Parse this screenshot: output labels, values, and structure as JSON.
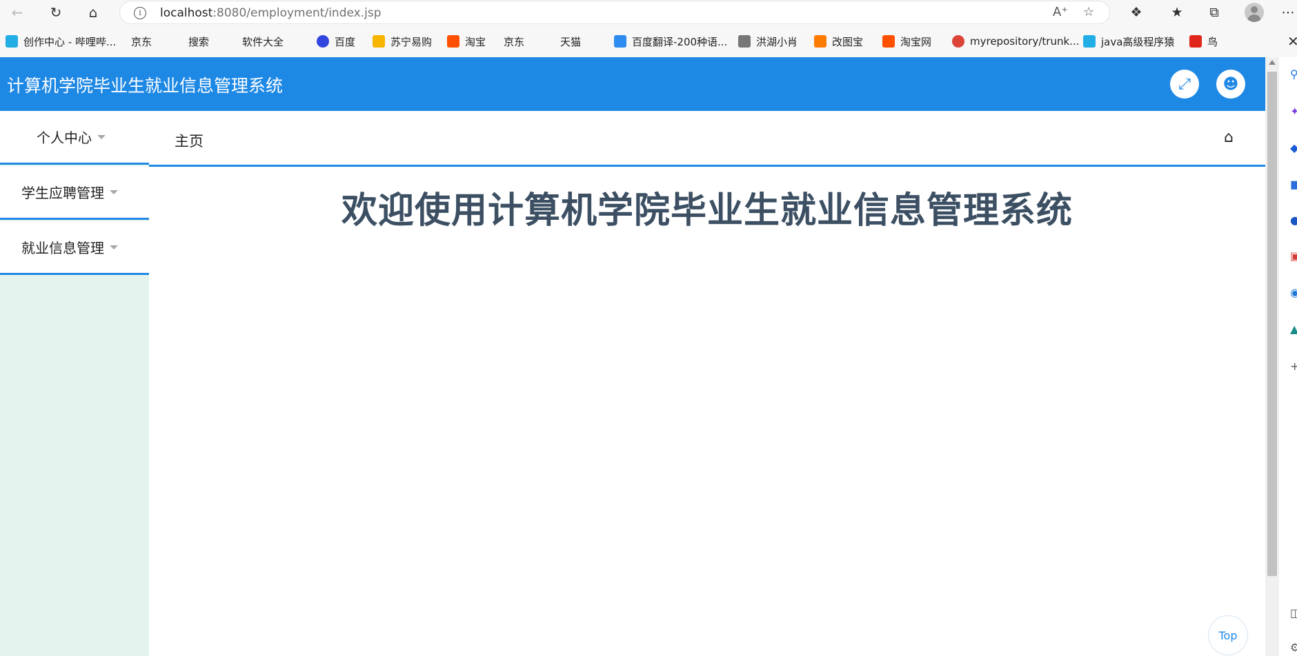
{
  "browser": {
    "url_host": "localhost",
    "url_rest": ":8080/employment/index.jsp",
    "bookmarks": [
      {
        "label": "创作中心 - 哔哩哔...",
        "icon": "bilibili-icon",
        "color": "#23ade5"
      },
      {
        "label": "京东",
        "icon": "page-icon"
      },
      {
        "label": "搜索",
        "icon": "page-icon"
      },
      {
        "label": "软件大全",
        "icon": "page-icon"
      },
      {
        "label": "百度",
        "icon": "baidu-icon",
        "color": "#3245df"
      },
      {
        "label": "苏宁易购",
        "icon": "suning-icon",
        "color": "#f7b500"
      },
      {
        "label": "淘宝",
        "icon": "taobao-icon",
        "color": "#ff5000"
      },
      {
        "label": "京东",
        "icon": "page-icon"
      },
      {
        "label": "天猫",
        "icon": "page-icon"
      },
      {
        "label": "百度翻译-200种语...",
        "icon": "baidu-translate-icon",
        "color": "#2d8cf0"
      },
      {
        "label": "洪湖小肖",
        "icon": "bird-icon",
        "color": "#777777"
      },
      {
        "label": "改图宝",
        "icon": "gaitubao-icon",
        "color": "#ff7a00"
      },
      {
        "label": "淘宝网",
        "icon": "taobao-icon",
        "color": "#ff5000"
      },
      {
        "label": "myrepository/trunk...",
        "icon": "chrome-icon",
        "color": "#db4437"
      },
      {
        "label": "java高级程序猿",
        "icon": "bilibili-icon",
        "color": "#23ade5"
      },
      {
        "label": "鸟",
        "icon": "feather-icon",
        "color": "#e0261b"
      }
    ]
  },
  "app": {
    "title": "计算机学院毕业生就业信息管理系统",
    "header_buttons": [
      "fullscreen-icon",
      "user-icon"
    ],
    "sidebar": [
      {
        "label": "个人中心"
      },
      {
        "label": "学生应聘管理"
      },
      {
        "label": "就业信息管理"
      }
    ],
    "tab": "主页",
    "welcome": "欢迎使用计算机学院毕业生就业信息管理系统",
    "top_button": "Top",
    "accent_color": "#1e88e5",
    "sidebar_bg": "#e4f3ee"
  }
}
